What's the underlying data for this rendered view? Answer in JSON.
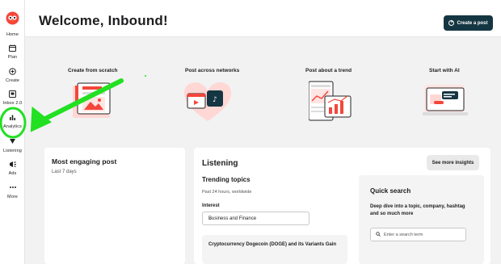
{
  "sidebar": {
    "logo": "owl-logo-icon",
    "items": [
      {
        "label": "Home",
        "icon": "home-icon"
      },
      {
        "label": "Plan",
        "icon": "calendar-icon"
      },
      {
        "label": "Create",
        "icon": "plus-circle-icon"
      },
      {
        "label": "Inbox 2.0",
        "icon": "inbox-icon"
      },
      {
        "label": "Analytics",
        "icon": "bar-chart-icon"
      },
      {
        "label": "Listening",
        "icon": "listening-icon"
      },
      {
        "label": "Ads",
        "icon": "megaphone-icon"
      },
      {
        "label": "More",
        "icon": "more-icon"
      }
    ]
  },
  "header": {
    "title": "Welcome, Inbound!",
    "create_label": "Create a post"
  },
  "quick_actions": [
    {
      "label": "Create from scratch"
    },
    {
      "label": "Post across networks"
    },
    {
      "label": "Post about a trend"
    },
    {
      "label": "Start with AI"
    }
  ],
  "engaging": {
    "title": "Most engaging post",
    "subtitle": "Last 7 days"
  },
  "listening": {
    "title": "Listening",
    "see_more": "See more insights",
    "trending_title": "Trending topics",
    "trending_sub": "Past 24 hours, worldwide",
    "interest_label": "Interest",
    "interest_value": "Business and Finance",
    "topic": "Cryptocurrency Dogecoin (DOGE) and its Variants Gain"
  },
  "quick_search": {
    "title": "Quick search",
    "description": "Deep dive into a topic, company, hashtag and so much more",
    "placeholder": "Enter a search term"
  },
  "colors": {
    "accent_dark": "#143642",
    "brand_red": "#f4463a",
    "annotation_green": "#22e022"
  }
}
